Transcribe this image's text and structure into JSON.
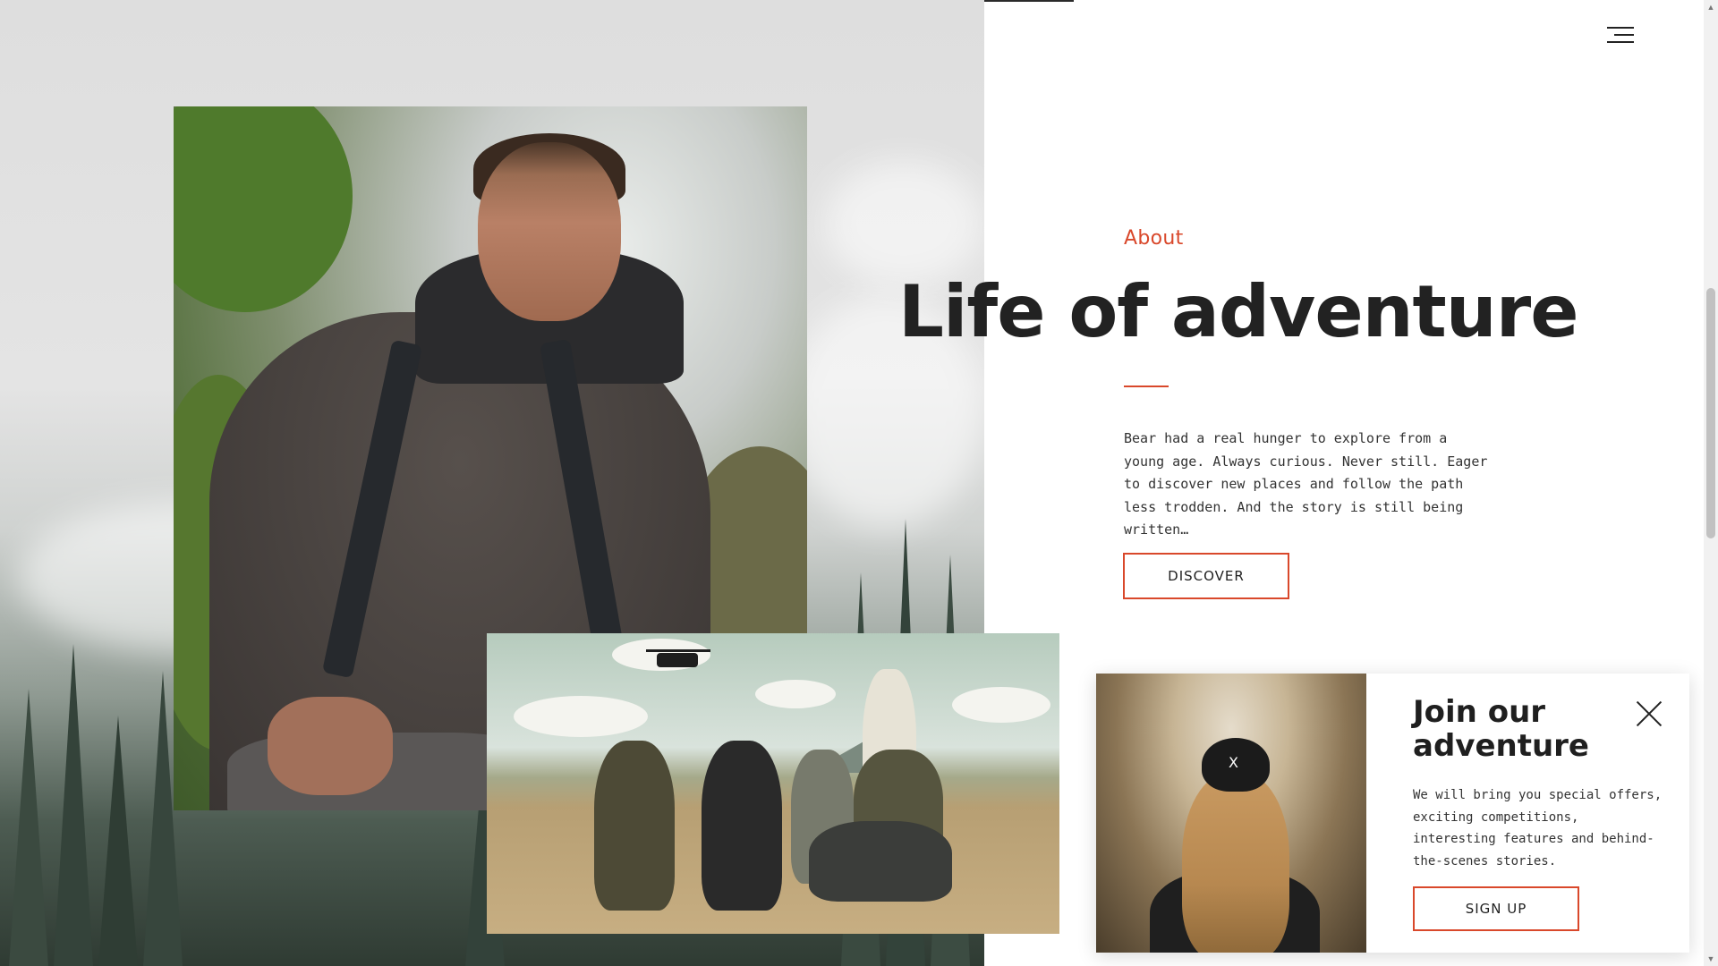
{
  "nav": {
    "menu_icon": "hamburger-menu-icon"
  },
  "about": {
    "eyebrow": "About",
    "title": "Life of adventure",
    "body": "Bear had a real hunger to explore from a young age. Always curious. Never still. Eager to discover new places and follow the path less trodden. And the story is still being written…",
    "cta_label": "DISCOVER"
  },
  "popup": {
    "title": "Join our adventure",
    "body": "We will bring you special offers, exciting competitions, interesting features and behind-the-scenes stories.",
    "cta_label": "SIGN UP",
    "close_icon": "close-icon",
    "cap_mark": "X"
  },
  "colors": {
    "accent": "#d9482b",
    "text": "#222222"
  }
}
